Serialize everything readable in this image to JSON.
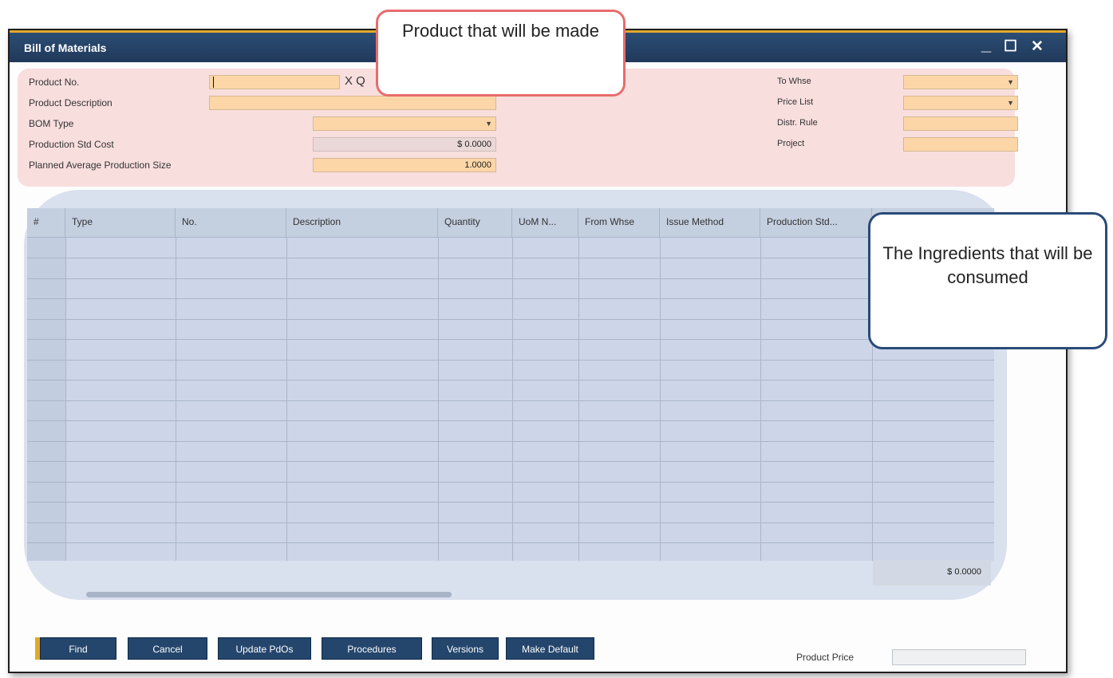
{
  "window": {
    "title": "Bill of Materials",
    "controls": {
      "minimize": "_",
      "maximize": "☐",
      "close": "✕"
    }
  },
  "header": {
    "product_no": {
      "label": "Product No.",
      "value": ""
    },
    "x_quantity_label": "X Q",
    "product_description": {
      "label": "Product Description",
      "value": ""
    },
    "bom_type": {
      "label": "BOM Type",
      "value": ""
    },
    "production_std_cost": {
      "label": "Production Std Cost",
      "value": "$ 0.0000"
    },
    "planned_avg_size": {
      "label": "Planned Average Production Size",
      "value": "1.0000"
    },
    "to_whse": {
      "label": "To Whse",
      "value": ""
    },
    "price_list": {
      "label": "Price List",
      "value": ""
    },
    "distr_rule": {
      "label": "Distr. Rule",
      "value": ""
    },
    "project": {
      "label": "Project",
      "value": ""
    }
  },
  "grid": {
    "columns": [
      "#",
      "Type",
      "No.",
      "Description",
      "Quantity",
      "UoM N...",
      "From Whse",
      "Issue Method",
      "Production Std..."
    ],
    "total": "$ 0.0000"
  },
  "footer": {
    "buttons": [
      "Find",
      "Cancel",
      "Update PdOs",
      "Procedures",
      "Versions",
      "Make Default"
    ],
    "product_price_label": "Product Price",
    "product_price_value": ""
  },
  "callouts": {
    "product": "Product that will be made",
    "ingredients": "The Ingredients that will be consumed"
  },
  "colors": {
    "titlebar": "#20395a",
    "accent": "#e1a92b",
    "field_orange": "#fcd6a7",
    "header_highlight": "#f9dede",
    "grid_highlight": "#d9e0ee",
    "callout_red": "#e86c6c",
    "callout_blue": "#2b4b78"
  }
}
